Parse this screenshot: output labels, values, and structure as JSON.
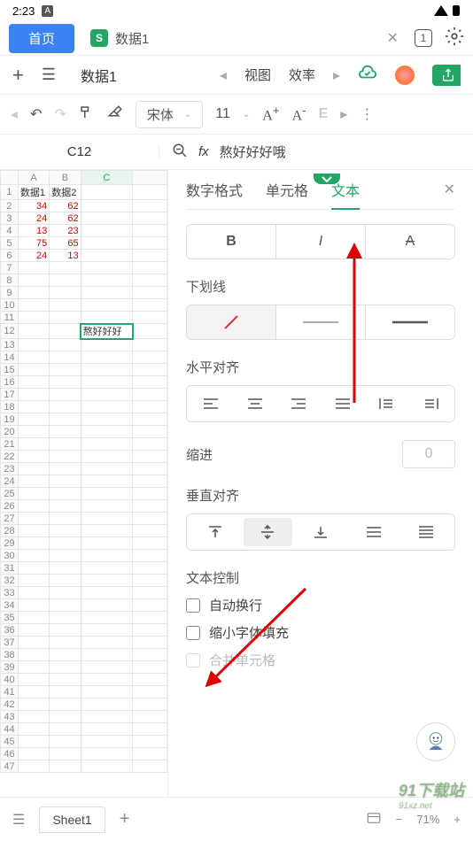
{
  "status": {
    "time": "2:23",
    "icon": "A"
  },
  "tabs": {
    "home": "首页",
    "file": "数据1",
    "file_icon": "S"
  },
  "toolbar": {
    "sheet": "数据1",
    "view": "视图",
    "mode": "效率"
  },
  "format": {
    "font": "宋体",
    "size": "11"
  },
  "cell": {
    "ref": "C12",
    "value": "熬好好好哦"
  },
  "sheet": {
    "cols": [
      "A",
      "B",
      "C"
    ],
    "rows": [
      {
        "n": 1,
        "a": "数据1",
        "b": "数据2",
        "c": ""
      },
      {
        "n": 2,
        "a": "34",
        "b": "62",
        "c": ""
      },
      {
        "n": 3,
        "a": "24",
        "b": "62",
        "c": ""
      },
      {
        "n": 4,
        "a": "13",
        "b": "23",
        "c": ""
      },
      {
        "n": 5,
        "a": "75",
        "b": "65",
        "c": ""
      },
      {
        "n": 6,
        "a": "24",
        "b": "13",
        "c": ""
      }
    ],
    "c12": "熬好好好"
  },
  "panel": {
    "tab_number": "数字格式",
    "tab_cell": "单元格",
    "tab_text": "文本",
    "underline": "下划线",
    "halign": "水平对齐",
    "indent": "缩进",
    "indent_val": "0",
    "valign": "垂直对齐",
    "textctrl": "文本控制",
    "wrap": "自动换行",
    "shrink": "缩小字体填充",
    "merge": "合并单元格"
  },
  "bottom": {
    "sheet": "Sheet1",
    "zoom": "71%"
  }
}
